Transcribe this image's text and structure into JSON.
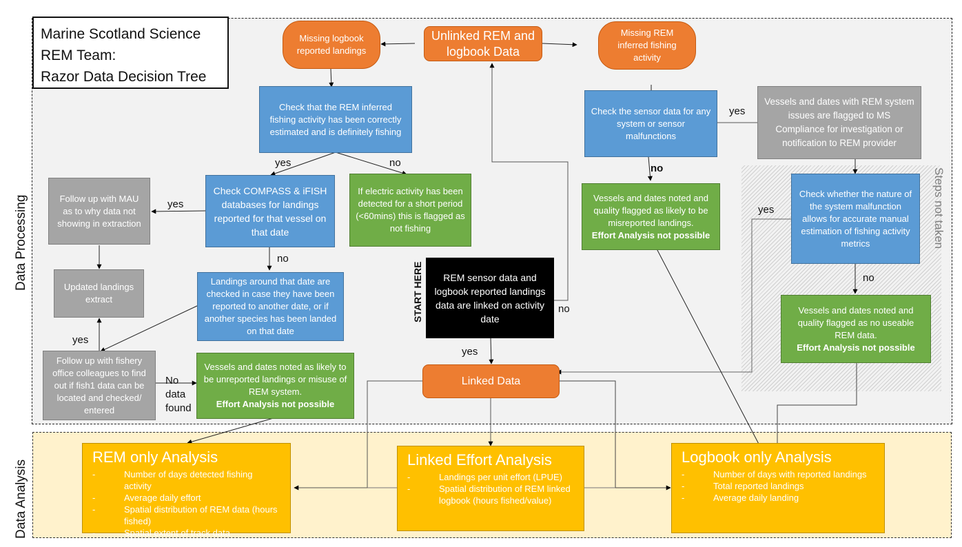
{
  "title": {
    "lines": [
      "Marine Scotland Science",
      "REM Team:",
      "Razor Data Decision Tree"
    ]
  },
  "zones": {
    "processing": "Data Processing",
    "analysis": "Data Analysis",
    "steps_not_taken": "Steps not taken"
  },
  "nodes": {
    "unlinked": "Unlinked REM and logbook Data",
    "missing_logbook": "Missing logbook reported landings",
    "missing_rem": "Missing REM inferred fishing activity",
    "check_rem_inferred": "Check that the REM inferred fishing activity has been correctly estimated and is definitely fishing",
    "check_compass": "Check COMPASS & iFISH databases for landings reported for that vessel on that date",
    "electric_activity": "If electric activity has been detected for a short period (<60mins) this is flagged as not fishing",
    "follow_up_mau": "Follow up with MAU as to why data not showing in extraction",
    "updated_extract": "Updated landings extract",
    "landings_around": "Landings around that date are checked in case they have been reported to another date, or if another species has been landed on that date",
    "follow_up_fishery": "Follow up with fishery office colleagues to find out if fish1 data can be located and checked/ entered",
    "unreported": {
      "text": "Vessels and dates noted as likely to be unreported landings or misuse of REM system.",
      "bold": "Effort Analysis not possible"
    },
    "start_label": "START HERE",
    "start": "REM sensor data and logbook reported landings data are linked on activity date",
    "linked_data": "Linked Data",
    "check_sensor": "Check the sensor data for any system or sensor malfunctions",
    "flagged_compliance": "Vessels and dates with REM system issues are flagged to MS Compliance for investigation or notification to REM provider",
    "misreported": {
      "text": "Vessels and dates noted and quality flagged as likely to be misreported landings.",
      "bold": "Effort Analysis not possible"
    },
    "check_malfunction": "Check whether the nature of the system malfunction allows for accurate manual estimation of fishing activity metrics",
    "no_useable": {
      "text": "Vessels and dates noted and quality flagged as no useable REM data.",
      "bold": "Effort Analysis not possible"
    }
  },
  "edge_labels": {
    "yes_compass": "yes",
    "no_electric": "no",
    "yes_mau": "yes",
    "no_landings": "no",
    "yes_fishery": "yes",
    "no_data_found": [
      "No",
      "data",
      "found"
    ],
    "yes_start": "yes",
    "no_start": "no",
    "yes_sensor": "yes",
    "no_sensor": "no",
    "yes_malfunction": "yes",
    "no_malfunction": "no"
  },
  "analysis": {
    "rem_only": {
      "title": "REM only Analysis",
      "items": [
        "Number of days  detected fishing activity",
        "Average daily effort",
        "Spatial distribution of REM data (hours fished)",
        "Spatial extent of track data"
      ]
    },
    "linked": {
      "title": "Linked Effort Analysis",
      "items": [
        "Landings per unit effort (LPUE)",
        "Spatial distribution of REM linked logbook (hours fished/value)"
      ]
    },
    "logbook_only": {
      "title": "Logbook only Analysis",
      "items": [
        "Number of days with reported landings",
        "Total reported landings",
        "Average daily landing"
      ]
    },
    "bullet": "-"
  },
  "colors": {
    "orange": "#ed7d31",
    "blue": "#5b9bd5",
    "green": "#70ad47",
    "grey": "#a5a5a5",
    "gold": "#ffc000",
    "analysis_bg": "#fff2cc",
    "processing_bg": "#f2f2f2"
  }
}
